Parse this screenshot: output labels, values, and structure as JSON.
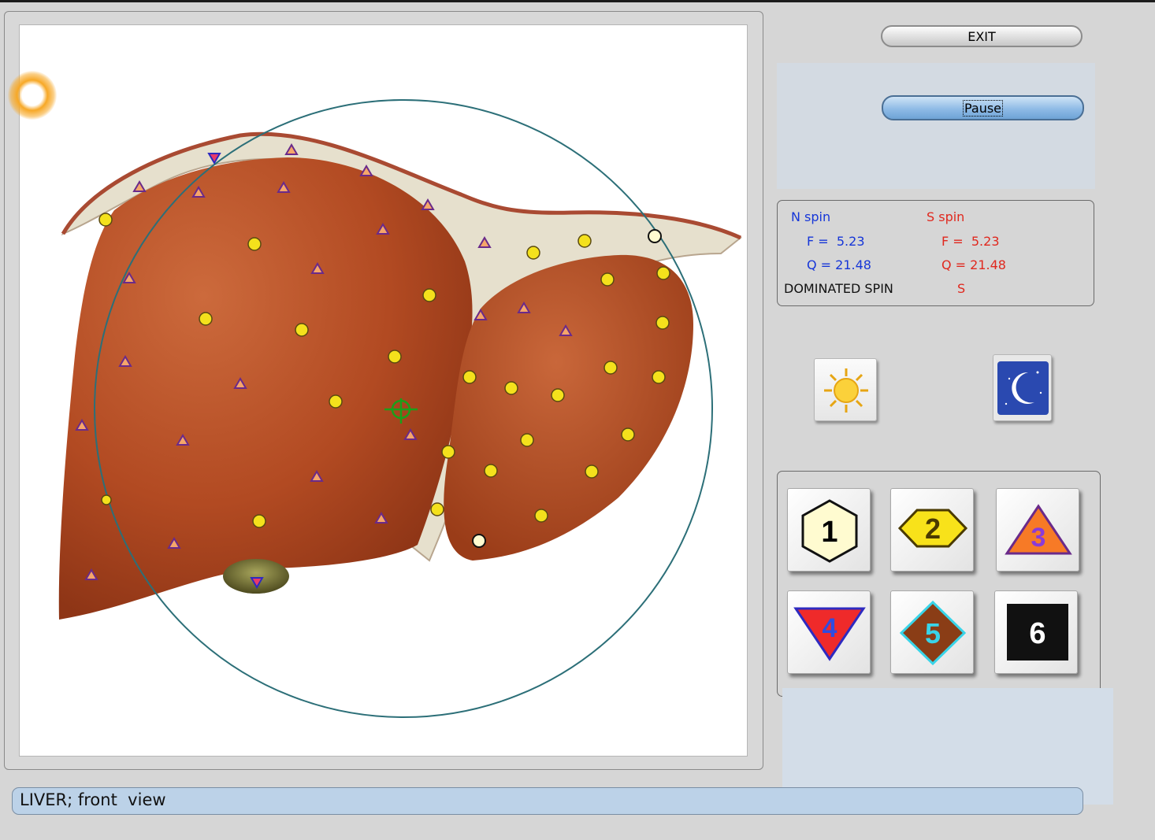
{
  "window": {
    "exit_label": "EXIT",
    "pause_label": "Pause"
  },
  "spin": {
    "n_title": "N spin",
    "n_f": "F =  5.23",
    "n_q": "Q = 21.48",
    "s_title": "S spin",
    "s_f": "F =  5.23",
    "s_q": "Q = 21.48",
    "dominated_label": "DOMINATED SPIN",
    "dominated_value": "S"
  },
  "mode_icons": [
    {
      "name": "sun-icon"
    },
    {
      "name": "moon-icon"
    }
  ],
  "shape_buttons": [
    {
      "label": "1",
      "shape": "hexagon",
      "fill": "#fffbd0",
      "text_color": "#000000"
    },
    {
      "label": "2",
      "shape": "hexagon-wide",
      "fill": "#f8e21a",
      "text_color": "#4a3a00"
    },
    {
      "label": "3",
      "shape": "triangle-up",
      "fill": "#f77a26",
      "text_color": "#8a3bd8"
    },
    {
      "label": "4",
      "shape": "triangle-down",
      "fill": "#ef2a2a",
      "text_color": "#2f4ce0"
    },
    {
      "label": "5",
      "shape": "diamond",
      "fill": "#8a3d16",
      "text_color": "#39d4e8"
    },
    {
      "label": "6",
      "shape": "square",
      "fill": "#111111",
      "text_color": "#ffffff"
    }
  ],
  "caption": "LIVER; front  view",
  "colors": {
    "liver": "#b24a22",
    "ligament": "#e9e3d0",
    "circle": "#2c6f78",
    "cursor": "#1aa01a",
    "glow": "#f7a826"
  }
}
